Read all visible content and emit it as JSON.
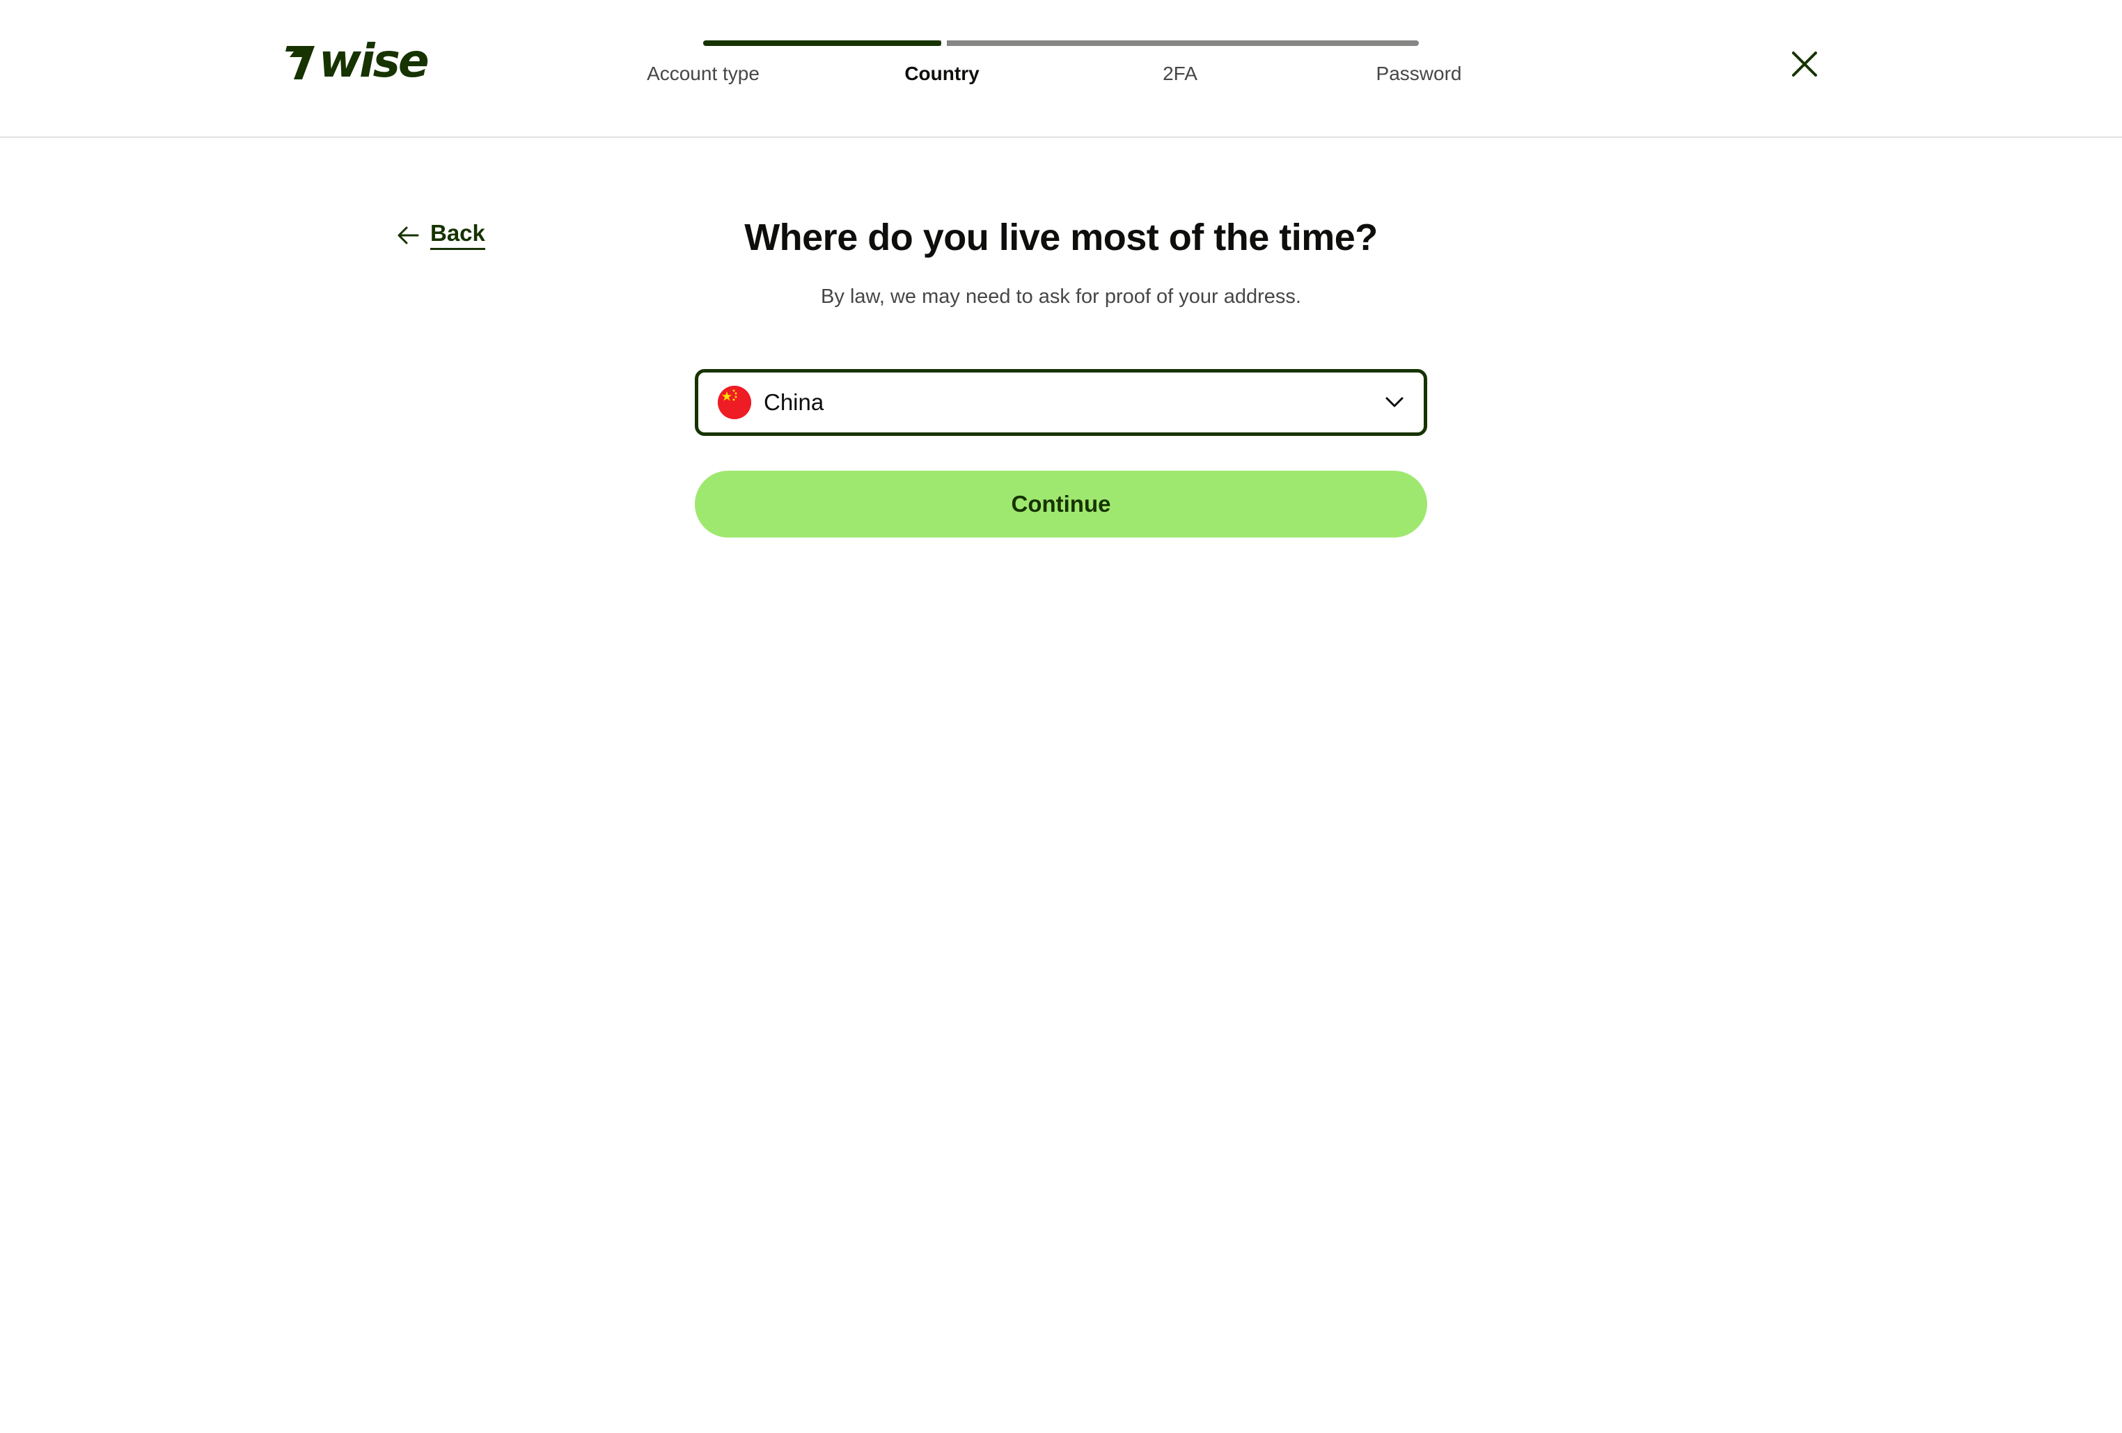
{
  "brand": {
    "name": "wise",
    "color": "#163300",
    "accent": "#9fe870"
  },
  "header": {
    "steps": [
      {
        "label": "Account type",
        "state": "completed"
      },
      {
        "label": "Country",
        "state": "active"
      },
      {
        "label": "2FA",
        "state": "upcoming"
      },
      {
        "label": "Password",
        "state": "upcoming"
      }
    ],
    "progress_fraction": 0.333,
    "close_icon": "close-icon"
  },
  "nav": {
    "back_label": "Back",
    "back_icon": "arrow-left-icon"
  },
  "main": {
    "title": "Where do you live most of the time?",
    "subtitle": "By law, we may need to ask for proof of your address.",
    "country_select": {
      "value": "China",
      "flag_icon": "china-flag-icon",
      "chevron_icon": "chevron-down-icon"
    },
    "continue_label": "Continue"
  }
}
